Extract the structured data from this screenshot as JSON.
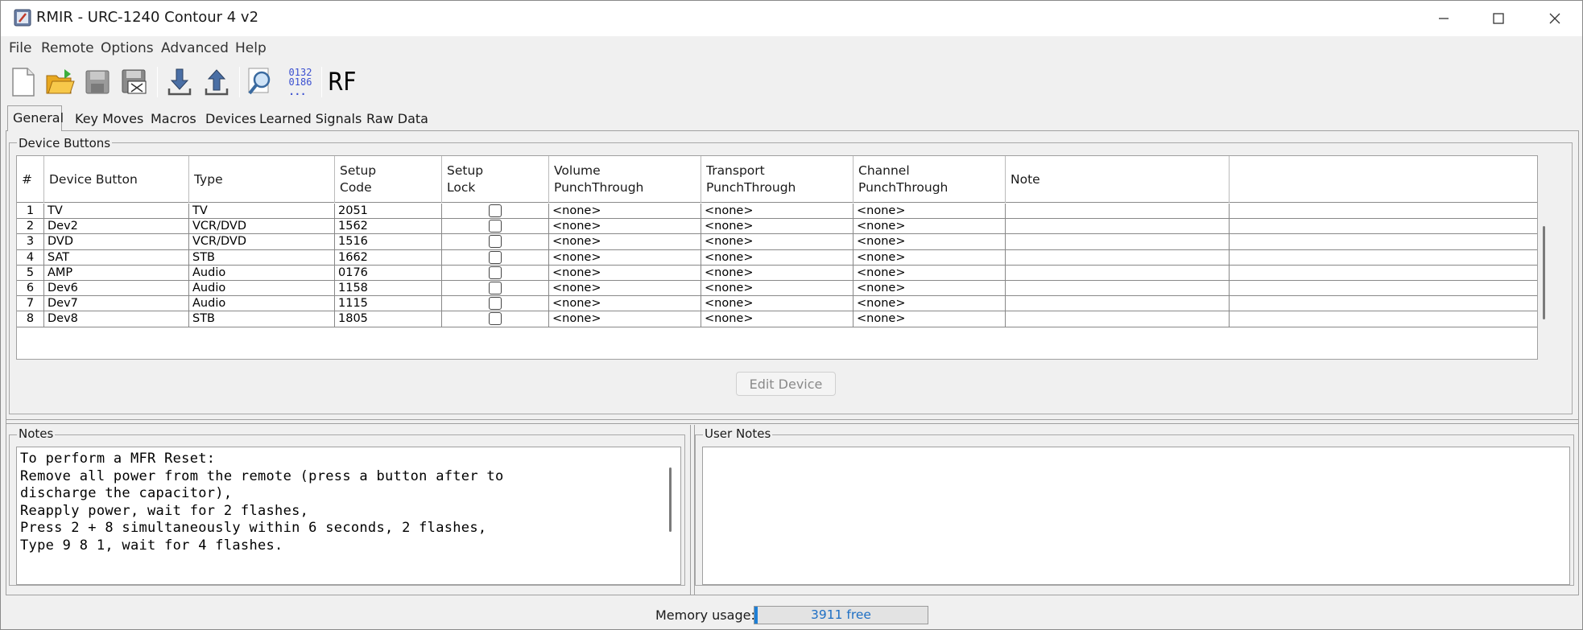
{
  "window": {
    "title": "RMIR - URC-1240 Contour 4 v2"
  },
  "menu": [
    "File",
    "Remote",
    "Options",
    "Advanced",
    "Help"
  ],
  "toolbar": {
    "code_icon_line1": "0132",
    "code_icon_line2": "0186",
    "code_icon_line3": "...",
    "rf_label": "RF"
  },
  "tabs": [
    "General",
    "Key Moves",
    "Macros",
    "Devices",
    "Learned Signals",
    "Raw Data"
  ],
  "device_buttons": {
    "group_label": "Device Buttons",
    "columns": [
      {
        "l1": "#",
        "l2": ""
      },
      {
        "l1": "Device Button",
        "l2": ""
      },
      {
        "l1": "Type",
        "l2": ""
      },
      {
        "l1": "Setup",
        "l2": "Code"
      },
      {
        "l1": "Setup",
        "l2": "Lock"
      },
      {
        "l1": "Volume",
        "l2": "PunchThrough"
      },
      {
        "l1": "Transport",
        "l2": "PunchThrough"
      },
      {
        "l1": "Channel",
        "l2": "PunchThrough"
      },
      {
        "l1": "Note",
        "l2": ""
      }
    ],
    "rows": [
      {
        "num": "1",
        "button": "TV",
        "type": "TV",
        "code": "2051",
        "lock": false,
        "vol": "<none>",
        "trans": "<none>",
        "chan": "<none>",
        "note": ""
      },
      {
        "num": "2",
        "button": "Dev2",
        "type": "VCR/DVD",
        "code": "1562",
        "lock": false,
        "vol": "<none>",
        "trans": "<none>",
        "chan": "<none>",
        "note": ""
      },
      {
        "num": "3",
        "button": "DVD",
        "type": "VCR/DVD",
        "code": "1516",
        "lock": false,
        "vol": "<none>",
        "trans": "<none>",
        "chan": "<none>",
        "note": ""
      },
      {
        "num": "4",
        "button": "SAT",
        "type": "STB",
        "code": "1662",
        "lock": false,
        "vol": "<none>",
        "trans": "<none>",
        "chan": "<none>",
        "note": ""
      },
      {
        "num": "5",
        "button": "AMP",
        "type": "Audio",
        "code": "0176",
        "lock": false,
        "vol": "<none>",
        "trans": "<none>",
        "chan": "<none>",
        "note": ""
      },
      {
        "num": "6",
        "button": "Dev6",
        "type": "Audio",
        "code": "1158",
        "lock": false,
        "vol": "<none>",
        "trans": "<none>",
        "chan": "<none>",
        "note": ""
      },
      {
        "num": "7",
        "button": "Dev7",
        "type": "Audio",
        "code": "1115",
        "lock": false,
        "vol": "<none>",
        "trans": "<none>",
        "chan": "<none>",
        "note": ""
      },
      {
        "num": "8",
        "button": "Dev8",
        "type": "STB",
        "code": "1805",
        "lock": false,
        "vol": "<none>",
        "trans": "<none>",
        "chan": "<none>",
        "note": ""
      }
    ],
    "edit_button": "Edit Device"
  },
  "notes": {
    "label": "Notes",
    "lines": [
      "To perform a MFR Reset:",
      "Remove all power from the remote (press a button after to",
      "discharge the capacitor),",
      "Reapply power, wait for 2 flashes,",
      "Press 2 + 8 simultaneously within 6 seconds, 2 flashes,",
      "Type 9 8 1, wait for 4 flashes."
    ]
  },
  "user_notes": {
    "label": "User Notes",
    "text": ""
  },
  "status": {
    "memory_label": "Memory usage:",
    "memory_value": "3911 free",
    "memory_used_fraction": 0.02
  },
  "colors": {
    "accent": "#1e7fd6",
    "window_bg": "#f0f0f0"
  }
}
